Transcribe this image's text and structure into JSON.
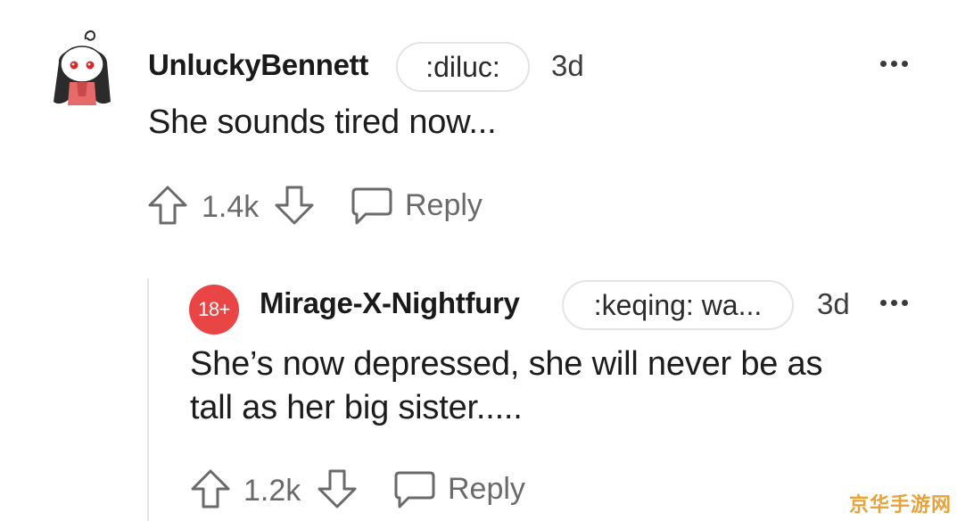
{
  "comments": [
    {
      "username": "UnluckyBennett",
      "flair": ":diluc:",
      "age": "3d",
      "text": "She sounds tired now...",
      "votes": "1.4k",
      "reply_label": "Reply",
      "avatar_icon": "ghost-avatar-icon"
    },
    {
      "username": "Mirage-X-Nightfury",
      "flair": ":keqing: wa...",
      "age": "3d",
      "text_line1": "She’s now depressed, she will never be as",
      "text_line2": "tall as her big sister.....",
      "votes": "1.2k",
      "reply_label": "Reply",
      "badge": "18+"
    }
  ],
  "watermark": "京华手游网",
  "colors": {
    "nsfw_badge": "#ea4545",
    "icon_gray": "#6a6a6a",
    "watermark": "#e8a23a"
  }
}
